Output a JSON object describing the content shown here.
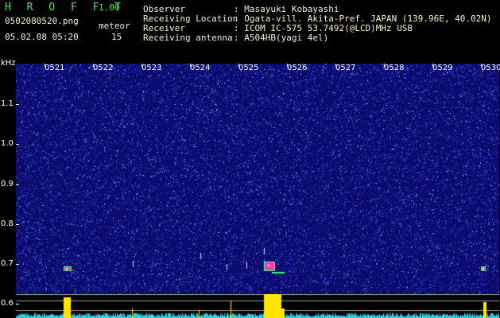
{
  "app": {
    "logo": "H R O F F T",
    "version": "1.00"
  },
  "file": {
    "name": "0502080520.png",
    "datetime": "05.02.08 05:20"
  },
  "meteor": {
    "label": "meteor",
    "count": "15"
  },
  "info": {
    "observer_label": "Observer",
    "observer_value": ": Masayuki Kobayashi",
    "location_label": "Receiving Location",
    "location_value": ": Ogata-vill. Akita-Pref. JAPAN (139.96E, 40.02N)",
    "receiver_label": "Receiver",
    "receiver_value": ": ICOM IC-575 53.7492(@LCD)MHz USB",
    "antenna_label": "Receiving antenna",
    "antenna_value": ": A504HB(yagi 4el)"
  },
  "axis": {
    "unit": "kHz",
    "y_ticks": [
      "1.1",
      "1.0",
      "0.9",
      "0.8",
      "0.7",
      "0.6"
    ],
    "x_ticks": [
      "0521",
      "0522",
      "0523",
      "0524",
      "0525",
      "0526",
      "0527",
      "0528",
      "0529",
      "0530"
    ]
  },
  "colors": {
    "background": "#0a0d6e",
    "noise": "#3b46d6",
    "signal": "#ffe600",
    "text": "#f5f0c8",
    "logo": "#5fdc5f"
  }
}
